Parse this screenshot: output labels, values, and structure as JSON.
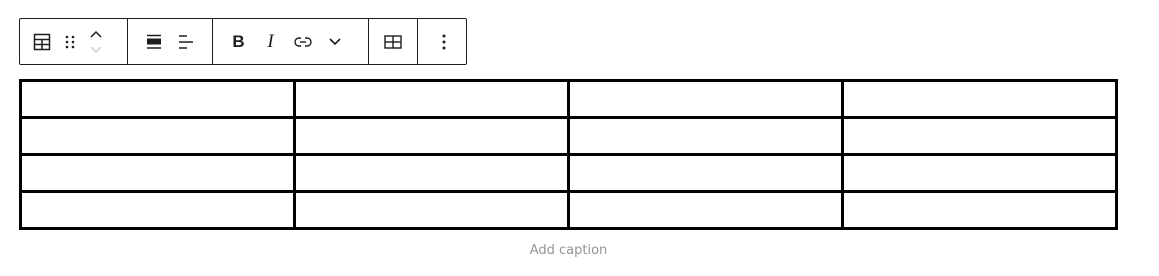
{
  "toolbar": {
    "block_type_icon": "table-icon",
    "drag_icon": "drag-handle-icon",
    "move_up_icon": "chevron-up-icon",
    "move_down_icon": "chevron-down-icon",
    "align_icon": "align-wide-icon",
    "text_align_icon": "align-left-icon",
    "bold_label": "B",
    "italic_label": "I",
    "link_icon": "link-icon",
    "more_format_icon": "chevron-down-icon",
    "edit_table_icon": "table-edit-icon",
    "options_icon": "more-vertical-icon"
  },
  "table": {
    "rows": [
      [
        "",
        "",
        "",
        ""
      ],
      [
        "",
        "",
        "",
        ""
      ],
      [
        "",
        "",
        "",
        ""
      ],
      [
        "",
        "",
        "",
        ""
      ]
    ]
  },
  "caption": {
    "placeholder": "Add caption"
  },
  "colors": {
    "border": "#000000",
    "toolbar_border": "#1e1e1e",
    "caption_placeholder": "#949494"
  }
}
